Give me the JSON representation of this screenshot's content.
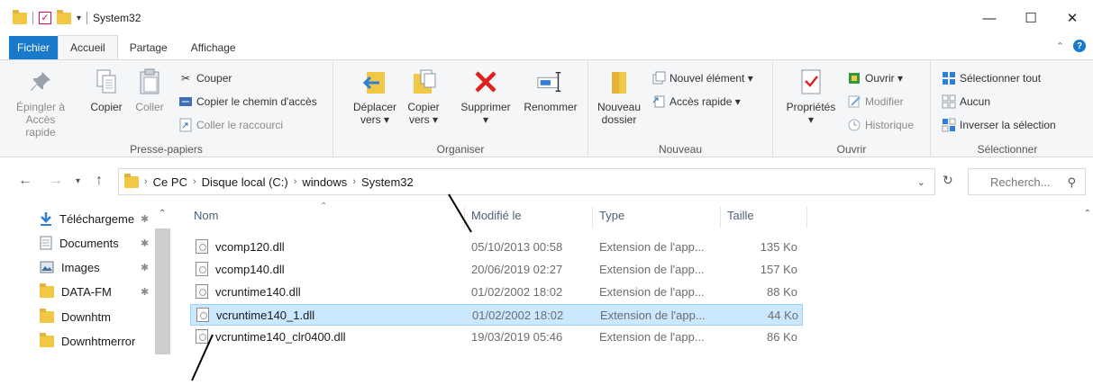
{
  "window": {
    "title": "System32",
    "minimize": "—",
    "maximize": "☐",
    "close": "✕"
  },
  "tabs": [
    "Fichier",
    "Accueil",
    "Partage",
    "Affichage"
  ],
  "ribbon": {
    "presse_papiers": {
      "label": "Presse-papiers",
      "pin": "Épingler à\nAccès rapide",
      "pin_l1": "Épingler à",
      "pin_l2": "Accès rapide",
      "copy": "Copier",
      "paste": "Coller",
      "cut": "Couper",
      "copy_path": "Copier le chemin d'accès",
      "paste_shortcut": "Coller le raccourci"
    },
    "organiser": {
      "label": "Organiser",
      "move_l1": "Déplacer",
      "move_l2": "vers ▾",
      "copy_l1": "Copier",
      "copy_l2": "vers ▾",
      "delete": "Supprimer",
      "delete_drop": "▾",
      "rename": "Renommer"
    },
    "nouveau": {
      "label": "Nouveau",
      "new_folder_l1": "Nouveau",
      "new_folder_l2": "dossier",
      "new_item": "Nouvel élément ▾",
      "quick_access": "Accès rapide ▾"
    },
    "ouvrir": {
      "label": "Ouvrir",
      "properties": "Propriétés",
      "properties_drop": "▾",
      "open": "Ouvrir ▾",
      "modify": "Modifier",
      "history": "Historique"
    },
    "selectionner": {
      "label": "Sélectionner",
      "select_all": "Sélectionner tout",
      "none": "Aucun",
      "invert": "Inverser la sélection"
    }
  },
  "address": {
    "crumbs": [
      "Ce PC",
      "Disque local (C:)",
      "windows",
      "System32"
    ],
    "search_placeholder": "Recherch..."
  },
  "nav": [
    {
      "label": "Téléchargeme",
      "pinned": true
    },
    {
      "label": "Documents",
      "pinned": true
    },
    {
      "label": "Images",
      "pinned": true
    },
    {
      "label": "DATA-FM",
      "pinned": true
    },
    {
      "label": "Downhtm",
      "pinned": false
    },
    {
      "label": "Downhtmerror",
      "pinned": false
    }
  ],
  "columns": {
    "name": "Nom",
    "date": "Modifié le",
    "type": "Type",
    "size": "Taille"
  },
  "files": [
    {
      "name": "vcomp120.dll",
      "date": "05/10/2013 00:58",
      "type": "Extension de l'app...",
      "size": "135 Ko"
    },
    {
      "name": "vcomp140.dll",
      "date": "20/06/2019 02:27",
      "type": "Extension de l'app...",
      "size": "157 Ko"
    },
    {
      "name": "vcruntime140.dll",
      "date": "01/02/2002 18:02",
      "type": "Extension de l'app...",
      "size": "88 Ko"
    },
    {
      "name": "vcruntime140_1.dll",
      "date": "01/02/2002 18:02",
      "type": "Extension de l'app...",
      "size": "44 Ko"
    },
    {
      "name": "vcruntime140_clr0400.dll",
      "date": "19/03/2019 05:46",
      "type": "Extension de l'app...",
      "size": "86 Ko"
    }
  ],
  "colors": {
    "accent": "#1979ca",
    "selection": "#cce8ff",
    "folder": "#f2c744",
    "delete_red": "#e02020"
  }
}
